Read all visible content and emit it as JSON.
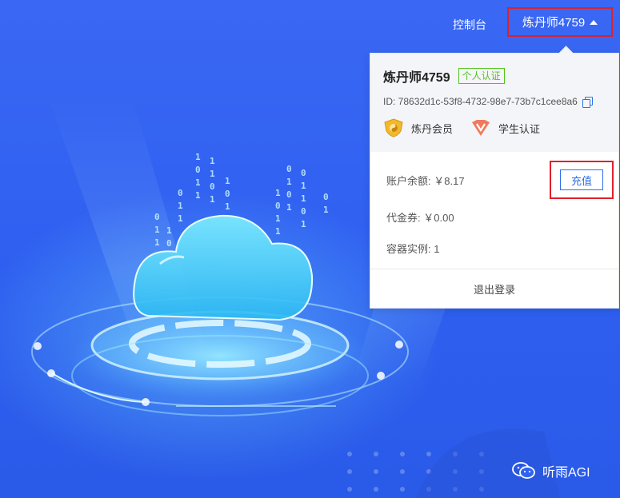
{
  "nav": {
    "console_label": "控制台",
    "user_label": "炼丹师4759"
  },
  "panel": {
    "username": "炼丹师4759",
    "verify_tag": "个人认证",
    "id_text": "ID: 78632d1c-53f8-4732-98e7-73b7c1cee8a6",
    "badges": [
      {
        "label": "炼丹会员",
        "icon": "gold-shield-icon"
      },
      {
        "label": "学生认证",
        "icon": "v-badge-icon"
      }
    ],
    "balance_label": "账户余额:",
    "balance_value": "￥8.17",
    "recharge_label": "充值",
    "voucher_label": "代金券:",
    "voucher_value": "￥0.00",
    "container_label": "容器实例:",
    "container_value": "1",
    "logout_label": "退出登录"
  },
  "watermark": {
    "text": "听雨AGI",
    "icon": "wechat-icon"
  },
  "colors": {
    "background": "#2f63f2",
    "highlight_border": "#e0202a",
    "primary": "#2f6fe8",
    "verify_green": "#52c41a"
  }
}
